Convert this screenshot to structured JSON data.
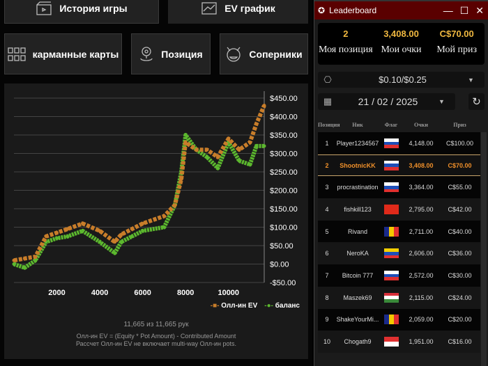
{
  "nav": {
    "history": "История игры",
    "ev_graph": "EV график",
    "pocket_cards": "карманные карты",
    "position": "Позиция",
    "opponents": "Соперники"
  },
  "chart_data": {
    "type": "line",
    "title": "",
    "xlabel": "",
    "ylabel": "",
    "x_ticks": [
      "2000",
      "4000",
      "6000",
      "8000",
      "10000"
    ],
    "y_ticks": [
      "$450.00",
      "$400.00",
      "$350.00",
      "$300.00",
      "$250.00",
      "$200.00",
      "$150.00",
      "$100.00",
      "$50.00",
      "$0.00",
      "-$50.00"
    ],
    "xlim": [
      0,
      11665
    ],
    "ylim": [
      -50,
      450
    ],
    "x": [
      0,
      500,
      1000,
      1500,
      2000,
      2500,
      3200,
      4000,
      4700,
      5000,
      5500,
      6000,
      7000,
      7500,
      7800,
      8000,
      8500,
      9000,
      9500,
      10000,
      10500,
      11000,
      11300,
      11665
    ],
    "series": [
      {
        "name": "Олл-ин EV",
        "color": "#c87d2a",
        "values": [
          10,
          15,
          20,
          75,
          85,
          95,
          110,
          90,
          60,
          80,
          95,
          110,
          130,
          160,
          230,
          330,
          310,
          310,
          290,
          340,
          310,
          330,
          380,
          430
        ]
      },
      {
        "name": "баланс",
        "color": "#5cb82e",
        "values": [
          0,
          -10,
          10,
          60,
          70,
          75,
          90,
          60,
          30,
          60,
          75,
          90,
          100,
          160,
          250,
          350,
          310,
          290,
          260,
          330,
          280,
          270,
          320,
          320
        ]
      }
    ],
    "legend": "bottom-right"
  },
  "hands_text": "11,665 из 11,665 рук",
  "note1": "Олл-ин EV = (Equity * Pot Amount) - Contributed Amount",
  "note2": "Рассчет Олл-ин EV не включает multi-way Олл-ин pots.",
  "leaderboard": {
    "title": "Leaderboard",
    "my_position": "2",
    "my_position_label": "Моя позиция",
    "my_points": "3,408.00",
    "my_points_label": "Мои очки",
    "my_prize": "C$70.00",
    "my_prize_label": "Мой приз",
    "stakes": "$0.10/$0.25",
    "date": "21 / 02 / 2025",
    "headers": [
      "Позиция",
      "Ник",
      "Флаг",
      "Очки",
      "Приз"
    ],
    "rows": [
      {
        "pos": "1",
        "nick": "Player1234567",
        "flag": "slovenia",
        "points": "4,148.00",
        "prize": "C$100.00"
      },
      {
        "pos": "2",
        "nick": "ShootnicKK",
        "flag": "russia",
        "points": "3,408.00",
        "prize": "C$70.00"
      },
      {
        "pos": "3",
        "nick": "procrastination",
        "flag": "russia",
        "points": "3,364.00",
        "prize": "C$55.00"
      },
      {
        "pos": "4",
        "nick": "fishkill123",
        "flag": "china",
        "points": "2,795.00",
        "prize": "C$42.00"
      },
      {
        "pos": "5",
        "nick": "Rivand",
        "flag": "andorra",
        "points": "2,711.00",
        "prize": "C$40.00"
      },
      {
        "pos": "6",
        "nick": "NeroKA",
        "flag": "venezuela",
        "points": "2,606.00",
        "prize": "C$36.00"
      },
      {
        "pos": "7",
        "nick": "Bitcoin 777",
        "flag": "russia",
        "points": "2,572.00",
        "prize": "C$30.00"
      },
      {
        "pos": "8",
        "nick": "Maszek69",
        "flag": "hungary",
        "points": "2,115.00",
        "prize": "C$24.00"
      },
      {
        "pos": "9",
        "nick": "ShakeYourMi...",
        "flag": "andorra",
        "points": "2,059.00",
        "prize": "C$20.00"
      },
      {
        "pos": "10",
        "nick": "Chogath9",
        "flag": "indonesia",
        "points": "1,951.00",
        "prize": "C$16.00"
      }
    ]
  }
}
